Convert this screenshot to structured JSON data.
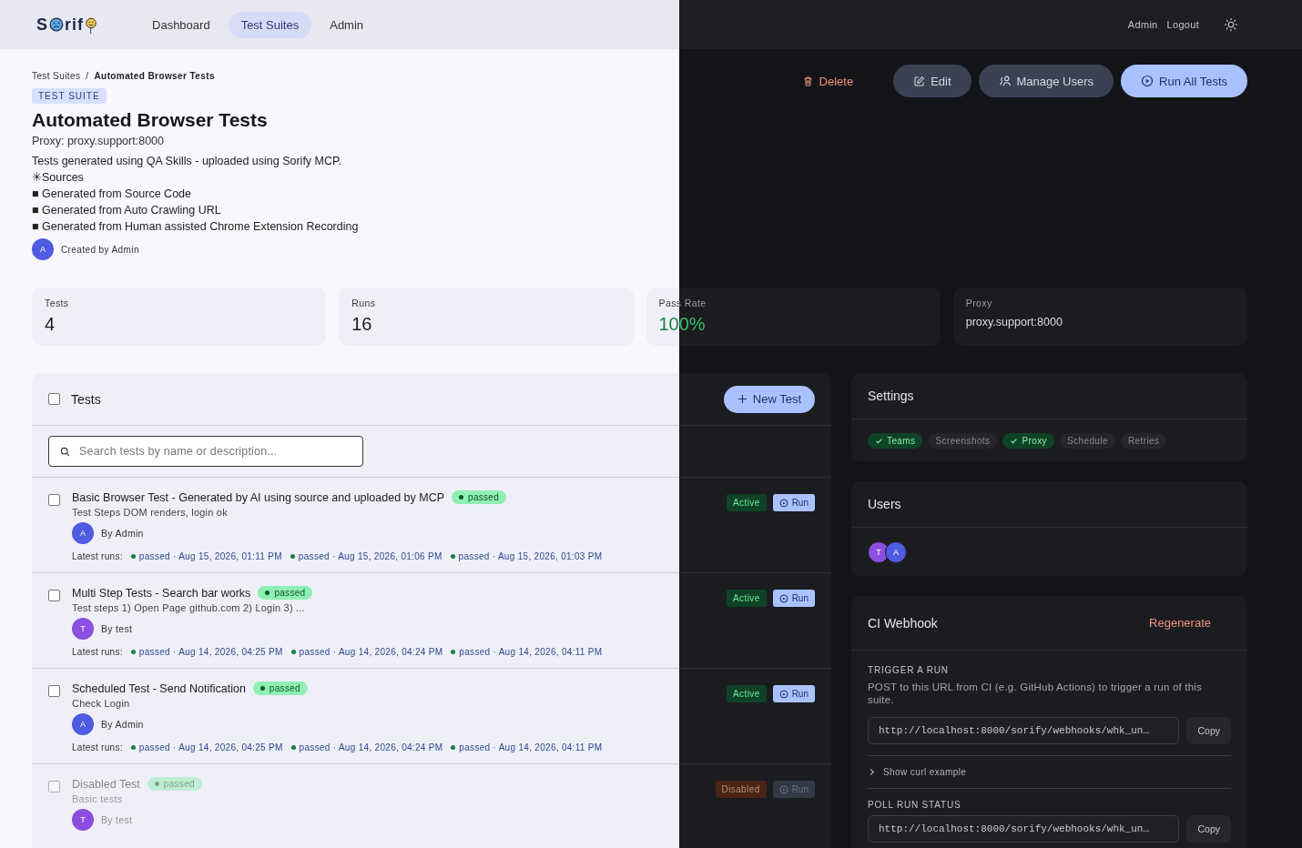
{
  "header": {
    "logo_before": "S",
    "logo_after": "rif",
    "nav": [
      {
        "label": "Dashboard",
        "selected": false
      },
      {
        "label": "Test Suites",
        "selected": true
      },
      {
        "label": "Admin",
        "selected": false
      }
    ],
    "user_links": [
      "Admin",
      "Logout"
    ]
  },
  "breadcrumb": [
    "Test Suites",
    "/",
    "Automated Browser Tests"
  ],
  "tag": "TEST SUITE",
  "title": "Automated Browser Tests",
  "proxy_line": "Proxy: proxy.support:8000",
  "description": [
    "Tests generated using QA Skills - uploaded using Sorify MCP.",
    "✳Sources",
    "■ Generated from Source Code",
    "■ Generated from Auto Crawling URL",
    "■ Generated from Human assisted Chrome Extension Recording"
  ],
  "created_by": {
    "initial": "A",
    "color": "#4f5be0",
    "text": "Created by Admin"
  },
  "actions": [
    {
      "label": "Delete",
      "kind": "danger"
    },
    {
      "label": "Edit",
      "kind": "secondary"
    },
    {
      "label": "Manage Users",
      "kind": "secondary"
    },
    {
      "label": "Run All Tests",
      "kind": "primary"
    }
  ],
  "stats": [
    {
      "label": "Tests",
      "value": "4",
      "kind": "number"
    },
    {
      "label": "Runs",
      "value": "16",
      "kind": "number"
    },
    {
      "label": "Pass Rate",
      "value": "100%",
      "kind": "rate"
    },
    {
      "label": "Proxy",
      "value": "proxy.support:8000",
      "kind": "text"
    }
  ],
  "tests": {
    "title": "Tests",
    "select_all_checked": false,
    "new_test": "New Test",
    "search_placeholder": "Search tests by name or description...",
    "items": [
      {
        "title": "Basic Browser Test - Generated by AI using source and uploaded by MCP",
        "status": "passed",
        "description": "Test Steps DOM renders, login ok",
        "initial": "A",
        "color": "#4f5be0",
        "author": "By Admin",
        "runs_label": "Latest runs:",
        "runs": [
          {
            "success": true,
            "text": "passed · Aug 15, 2026, 01:11 PM"
          },
          {
            "success": true,
            "text": "passed · Aug 15, 2026, 01:06 PM"
          },
          {
            "success": true,
            "text": "passed · Aug 15, 2026, 01:03 PM"
          }
        ],
        "state": "Active",
        "disabled": false,
        "checked": false,
        "run": "Run"
      },
      {
        "title": "Multi Step Tests - Search bar works",
        "status": "passed",
        "description": "Test steps 1) Open Page github.com 2) Login 3) ...",
        "initial": "T",
        "color": "#8b4fe0",
        "author": "By test",
        "runs_label": "Latest runs:",
        "runs": [
          {
            "success": true,
            "text": "passed · Aug 14, 2026, 04:25 PM"
          },
          {
            "success": true,
            "text": "passed · Aug 14, 2026, 04:24 PM"
          },
          {
            "success": true,
            "text": "passed · Aug 14, 2026, 04:11 PM"
          }
        ],
        "state": "Active",
        "disabled": false,
        "checked": false,
        "run": "Run"
      },
      {
        "title": "Scheduled Test - Send Notification",
        "status": "passed",
        "description": "Check Login",
        "initial": "A",
        "color": "#4f5be0",
        "author": "By Admin",
        "runs_label": "Latest runs:",
        "runs": [
          {
            "success": true,
            "text": "passed · Aug 14, 2026, 04:25 PM"
          },
          {
            "success": true,
            "text": "passed · Aug 14, 2026, 04:24 PM"
          },
          {
            "success": true,
            "text": "passed · Aug 14, 2026, 04:11 PM"
          }
        ],
        "state": "Active",
        "disabled": false,
        "checked": false,
        "run": "Run"
      },
      {
        "title": "Disabled Test",
        "status": "passed",
        "description": "Basic tests",
        "initial": "T",
        "color": "#8b4fe0",
        "author": "By test",
        "state": "Disabled",
        "disabled": true,
        "checked": false,
        "run": "Run"
      }
    ]
  },
  "settings": {
    "title": "Settings",
    "chips": [
      {
        "label": "Teams",
        "on": true
      },
      {
        "label": "Screenshots",
        "on": false
      },
      {
        "label": "Proxy",
        "on": true
      },
      {
        "label": "Schedule",
        "on": false
      },
      {
        "label": "Retries",
        "on": false
      }
    ]
  },
  "users": {
    "title": "Users",
    "avatars": [
      {
        "initial": "T",
        "color": "#8b4fe0"
      },
      {
        "initial": "A",
        "color": "#4f5be0"
      }
    ]
  },
  "webhook": {
    "title": "CI Webhook",
    "regenerate": "Regenerate",
    "trigger": {
      "heading": "TRIGGER A RUN",
      "description": "POST to this URL from CI (e.g. GitHub Actions) to trigger a run of this suite.",
      "url": "http://localhost:8000/sorify/webhooks/whk_un…",
      "copy": "Copy"
    },
    "curl": {
      "label": "Show curl example",
      "expanded": false
    },
    "poll": {
      "heading": "POLL RUN STATUS",
      "url": "http://localhost:8000/sorify/webhooks/whk_un…",
      "copy": "Copy"
    }
  }
}
